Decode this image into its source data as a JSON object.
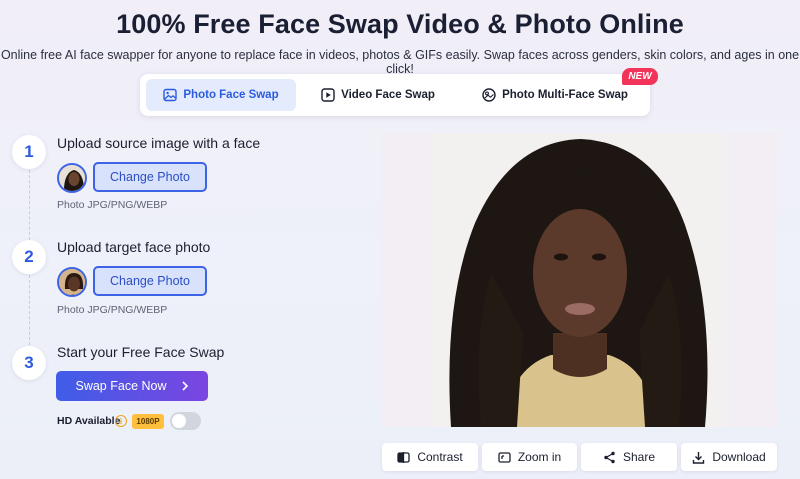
{
  "header": {
    "title": "100% Free Face Swap Video & Photo Online",
    "subtitle": "Online free AI face swapper for anyone to replace face in videos, photos & GIFs easily. Swap faces across genders, skin colors, and ages in one click!"
  },
  "tabs": [
    {
      "label": "Photo Face Swap",
      "icon": "image-icon",
      "active": true
    },
    {
      "label": "Video Face Swap",
      "icon": "play-icon",
      "active": false
    },
    {
      "label": "Photo Multi-Face Swap",
      "icon": "multi-face-icon",
      "active": false
    }
  ],
  "new_badge": "NEW",
  "steps": [
    {
      "number": "1",
      "title": "Upload source image with a face",
      "button": "Change Photo",
      "hint": "Photo JPG/PNG/WEBP"
    },
    {
      "number": "2",
      "title": "Upload target face photo",
      "button": "Change Photo",
      "hint": "Photo JPG/PNG/WEBP"
    },
    {
      "number": "3",
      "title": "Start your Free Face Swap",
      "button": "Swap Face Now"
    }
  ],
  "hd": {
    "label": "HD Available",
    "info_icon": "i",
    "resolution": "1080P",
    "enabled": false
  },
  "actions": [
    {
      "label": "Contrast",
      "icon": "contrast-icon"
    },
    {
      "label": "Zoom in",
      "icon": "zoom-in-icon"
    },
    {
      "label": "Share",
      "icon": "share-icon"
    },
    {
      "label": "Download",
      "icon": "download-icon"
    }
  ],
  "colors": {
    "accent": "#2c5be0",
    "new_badge": "#f2335a",
    "swap_gradient_start": "#3f5de8",
    "swap_gradient_end": "#7b45e0",
    "res_badge": "#ffbe3b"
  }
}
